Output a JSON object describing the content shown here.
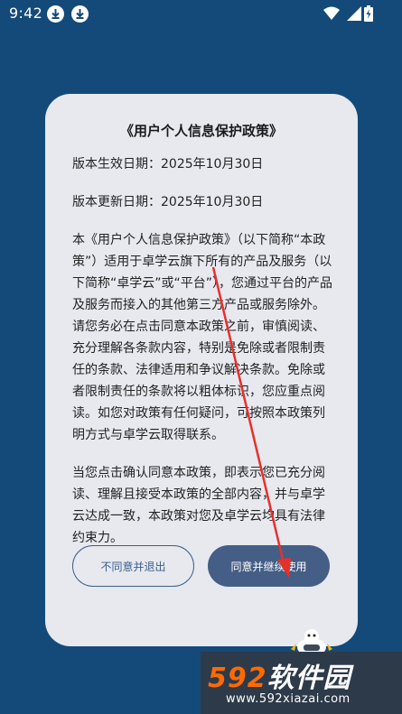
{
  "status_bar": {
    "time": "9:42",
    "icons": [
      "download-icon",
      "download-icon",
      "wifi-icon",
      "signal-icon",
      "battery-charging-icon"
    ]
  },
  "dialog": {
    "title": "《用户个人信息保护政策》",
    "effective_date": "版本生效日期：2025年10月30日",
    "updated_date": "版本更新日期：2025年10月30日",
    "paragraph_1": "本《用户个人信息保护政策》（以下简称“本政策”）适用于卓学云旗下所有的产品及服务（以下简称“卓学云”或“平台”），您通过平台的产品及服务而接入的其他第三方产品或服务除外。请您务必在点击同意本政策之前，审慎阅读、充分理解各条款内容，特别是免除或者限制责任的条款、法律适用和争议解决条款。免除或者限制责任的条款将以粗体标识，您应重点阅读。如您对政策有任何疑问，可按照本政策列明方式与卓学云取得联系。",
    "paragraph_2": "当您点击确认同意本政策，即表示您已充分阅读、理解且接受本政策的全部内容，并与卓学云达成一致，本政策对您及卓学云均具有法律约束力。",
    "decline_button": "不同意并退出",
    "accept_button": "同意并继续使用"
  },
  "annotation": {
    "arrow_color": "#e8302a"
  },
  "watermark": {
    "title_digits": "592",
    "title_text": "软件园",
    "url": "www.592xiazai.com"
  },
  "colors": {
    "background": "#144a79",
    "dialog": "#e7e9ef",
    "accent": "#445e86"
  }
}
